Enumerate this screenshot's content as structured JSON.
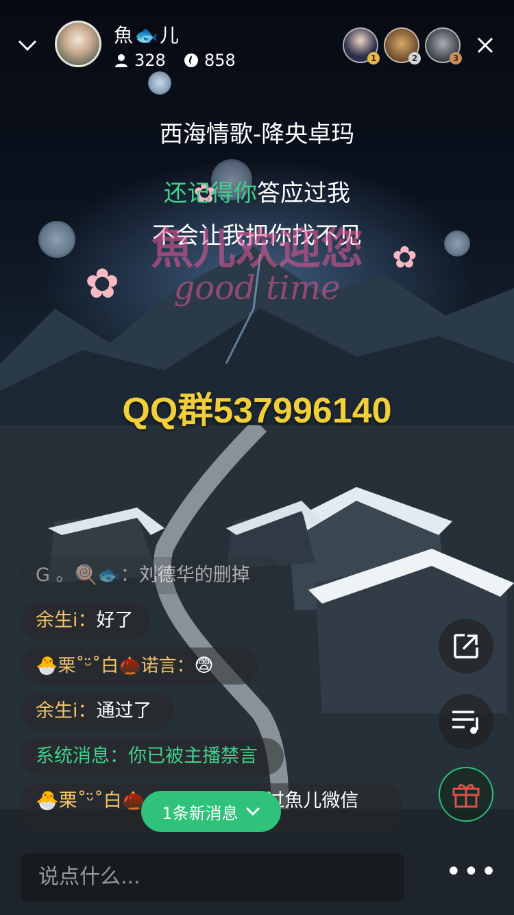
{
  "host": {
    "name": "魚🐟儿",
    "followers": "328",
    "hot": "858"
  },
  "song": {
    "title": "西海情歌-降央卓玛"
  },
  "lyrics": {
    "line1_highlight": "还记得你",
    "line1_rest": "答应过我",
    "line2": "不会让我把你找不见"
  },
  "watermark": {
    "line1": "魚儿欢迎您",
    "line2": "good time",
    "qq": "QQ群537996140"
  },
  "viewers": [
    {
      "rank": "1"
    },
    {
      "rank": "2"
    },
    {
      "rank": "3"
    }
  ],
  "chat": [
    {
      "name": "G 。🍭🐟：",
      "text": "刘德华的删掉"
    },
    {
      "name": "余生i：",
      "text": "好了"
    },
    {
      "name": "🐣栗˚ᵕ̈˚白🌰诺言：",
      "text": "😨"
    },
    {
      "name": "余生i：",
      "text": "通过了"
    },
    {
      "name": "系统消息：",
      "text": "你已被主播禁言"
    },
    {
      "name": "🐣栗˚ᵕ̈˚白🌰",
      "text": "加过魚儿微信"
    }
  ],
  "new_message": "1条新消息",
  "input": {
    "placeholder": "说点什么..."
  },
  "colors": {
    "accent": "#2fc27a",
    "qq_yellow": "#f1cf3a",
    "username": "#f5c46a"
  },
  "icons": [
    "chevron-down-icon",
    "user-icon",
    "flame-icon",
    "close-icon",
    "share-icon",
    "playlist-icon",
    "gift-icon",
    "more-icon"
  ]
}
